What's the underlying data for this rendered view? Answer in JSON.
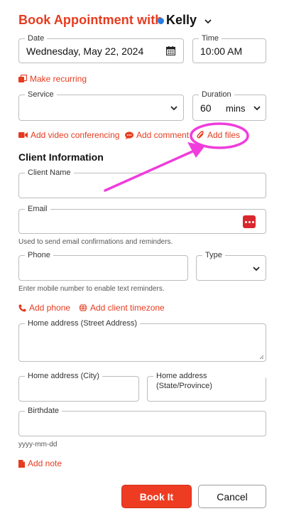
{
  "header": {
    "title": "Book Appointment with",
    "staff_name": "Kelly"
  },
  "date": {
    "label": "Date",
    "value": "Wednesday, May 22, 2024"
  },
  "time": {
    "label": "Time",
    "value": "10:00 AM"
  },
  "make_recurring": "Make recurring",
  "service": {
    "label": "Service",
    "value": ""
  },
  "duration": {
    "label": "Duration",
    "value": "60",
    "unit": "mins"
  },
  "actions": {
    "video": "Add video conferencing",
    "comment": "Add comment",
    "files": "Add files"
  },
  "client_section_title": "Client Information",
  "client_name": {
    "label": "Client Name",
    "value": ""
  },
  "email": {
    "label": "Email",
    "value": "",
    "helper": "Used to send email confirmations and reminders."
  },
  "phone": {
    "label": "Phone",
    "value": "",
    "helper": "Enter mobile number to enable text reminders."
  },
  "type": {
    "label": "Type",
    "value": ""
  },
  "add_phone": "Add phone",
  "add_timezone": "Add client timezone",
  "home_street": {
    "label": "Home address (Street Address)"
  },
  "home_city": {
    "label": "Home address (City)"
  },
  "home_state": {
    "label": "Home address (State/Province)"
  },
  "birthdate": {
    "label": "Birthdate",
    "helper": "yyyy-mm-dd"
  },
  "add_note": "Add note",
  "buttons": {
    "book": "Book It",
    "cancel": "Cancel"
  },
  "colors": {
    "accent": "#e63b1f",
    "annotation": "#f03cdc",
    "staff_dot": "#2a7de1"
  },
  "icons": [
    "calendar-icon",
    "recurring-icon",
    "video-icon",
    "comment-icon",
    "paperclip-icon",
    "phone-icon",
    "globe-icon",
    "note-icon",
    "chevron-down-icon",
    "password-manager-icon"
  ]
}
